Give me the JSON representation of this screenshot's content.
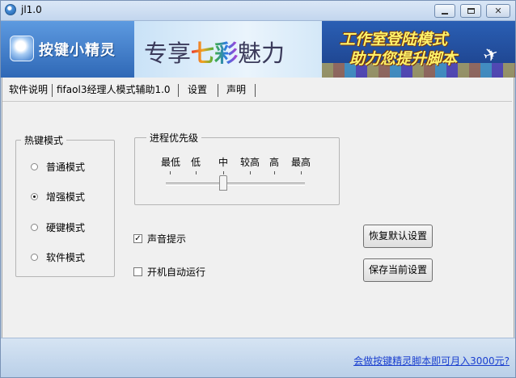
{
  "window": {
    "title": "jl1.0",
    "icon": "app-icon",
    "controls": [
      "minimize-icon",
      "maximize-icon",
      "close-icon"
    ]
  },
  "banner": {
    "logo_text": "按键小精灵",
    "promo1_prefix": "专享",
    "promo1_highlight": "七彩",
    "promo1_suffix": "魅力",
    "promo2_line1": "工作室登陆模式",
    "promo2_line2": "助力您提升脚本"
  },
  "tabs": [
    {
      "label": "软件说明"
    },
    {
      "label": "fifaol3经理人模式辅助1.0"
    },
    {
      "label": "设置",
      "active": true
    },
    {
      "label": "声明"
    }
  ],
  "hotkey_group": {
    "title": "热键模式",
    "options": [
      {
        "label": "普通模式",
        "checked": false
      },
      {
        "label": "增强模式",
        "checked": true
      },
      {
        "label": "硬键模式",
        "checked": false
      },
      {
        "label": "软件模式",
        "checked": false
      }
    ]
  },
  "priority_group": {
    "title": "进程优先级",
    "levels": [
      "最低",
      "低",
      "中",
      "较高",
      "高",
      "最高"
    ],
    "selected": "中"
  },
  "checkboxes": {
    "sound_prompt": {
      "label": "声音提示",
      "checked": true
    },
    "autostart": {
      "label": "开机自动运行",
      "checked": false
    }
  },
  "buttons": {
    "restore_defaults": "恢复默认设置",
    "save_settings": "保存当前设置"
  },
  "footer": {
    "ad_link": "会做按键精灵脚本即可月入3000元?"
  },
  "colors": {
    "link": "#1a3fcf",
    "frame": "#c9d9ec"
  }
}
